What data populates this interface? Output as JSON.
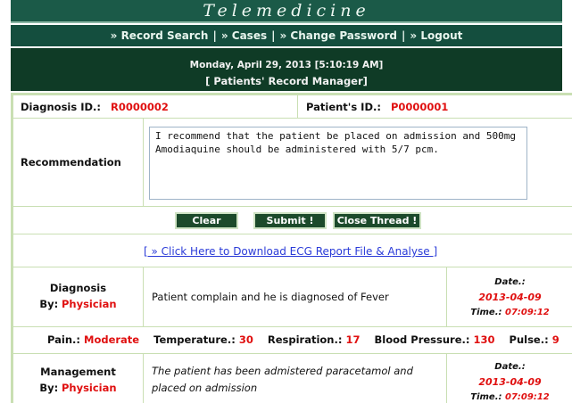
{
  "header": {
    "title": "Telemedicine"
  },
  "nav": {
    "items": [
      "» Record Search",
      "» Cases",
      "» Change Password",
      "» Logout"
    ],
    "separator": "|"
  },
  "datebar": {
    "date": "Monday, April 29, 2013 [5:10:19 AM]",
    "section": "[ Patients' Record Manager]"
  },
  "record": {
    "diagnosis_id_label": "Diagnosis ID.:",
    "diagnosis_id": "R0000002",
    "patient_id_label": "Patient's ID.:",
    "patient_id": "P0000001",
    "recommendation_label": "Recommendation",
    "recommendation_text": "I recommend that the patient be placed on admission and 500mg Amodiaquine should be administered with 5/7 pcm."
  },
  "buttons": {
    "clear": "Clear",
    "submit": "Submit !",
    "close": "Close Thread !"
  },
  "ecg_link": "[ » Click Here to Download ECG Report File & Analyse  ]",
  "diagnosis": {
    "label": "Diagnosis",
    "by_label": "By:",
    "by": "Physician",
    "text": "Patient complain and he is diagnosed of Fever",
    "date_label": "Date.:",
    "date": "2013-04-09",
    "time_label": "Time.:",
    "time": "07:09:12"
  },
  "vitals": {
    "pain_label": "Pain.:",
    "pain": "Moderate",
    "temperature_label": "Temperature.:",
    "temperature": "30",
    "respiration_label": "Respiration.:",
    "respiration": "17",
    "bp_label": "Blood Pressure.:",
    "bp": "130",
    "pulse_label": "Pulse.:",
    "pulse": "9"
  },
  "management": {
    "label": "Management",
    "by_label": "By:",
    "by": "Physician",
    "text": "The patient has been admistered paracetamol and placed on admission",
    "date_label": "Date.:",
    "date": "2013-04-09",
    "time_label": "Time.:",
    "time": "07:09:12"
  },
  "colors": {
    "header_green": "#1b5a48",
    "nav_green": "#144e3e",
    "dark_green": "#0f3b26",
    "accent_red": "#e01010",
    "link_blue": "#2a3bd8",
    "border": "#c9dfb3"
  }
}
